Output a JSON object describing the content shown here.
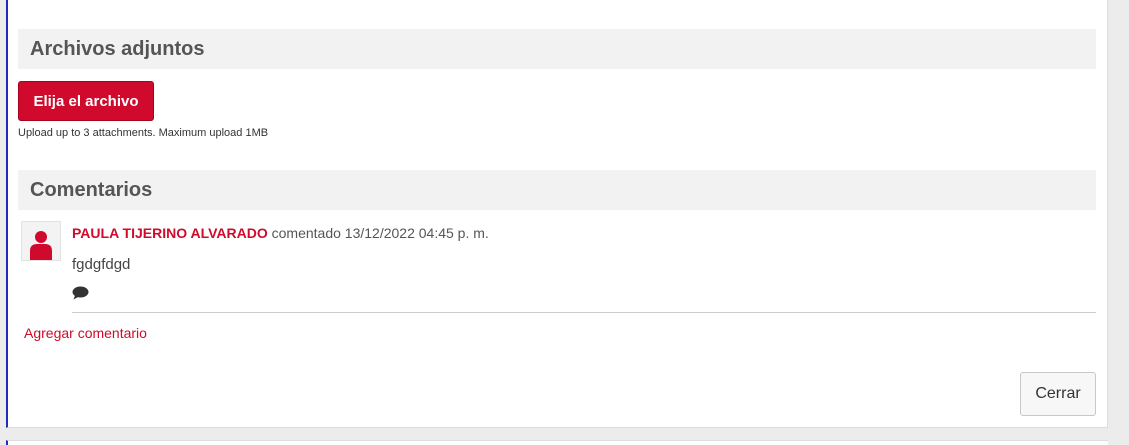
{
  "attachments": {
    "title": "Archivos adjuntos",
    "choose_button": "Elija el archivo",
    "upload_note": "Upload up to 3 attachments. Maximum upload 1MB"
  },
  "comments": {
    "title": "Comentarios",
    "items": [
      {
        "author": "PAULA TIJERINO ALVARADO",
        "meta": " comentado 13/12/2022 04:45 p. m.",
        "body": "fgdgfdgd"
      }
    ],
    "add_comment": "Agregar comentario"
  },
  "footer": {
    "close_button": "Cerrar"
  },
  "icons": {
    "avatar": "user-icon",
    "reply": "comment-bubble-icon"
  },
  "colors": {
    "accent": "#cf0a2c",
    "header_bg": "#f2f2f2",
    "frame_border": "#1f2db8"
  }
}
